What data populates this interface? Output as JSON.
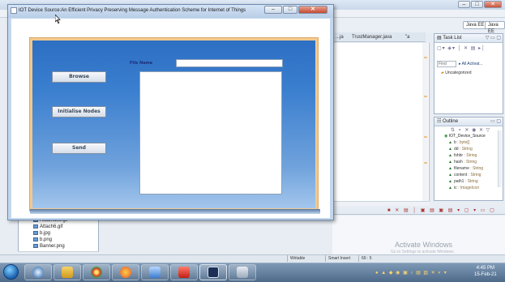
{
  "eclipse": {
    "perspectives": [
      "Java EE",
      "Java EE"
    ],
    "editor_tabs": [
      "...ja",
      "TrustManager.java",
      "\"a"
    ],
    "task_list": {
      "title": "Task List",
      "find_placeholder": "Find",
      "filter": "All  Activat...",
      "category": "Uncategorized"
    },
    "outline": {
      "title": "Outline",
      "root": "IOT_Device_Source",
      "items": [
        {
          "name": "b",
          "type": ": byte[]"
        },
        {
          "name": "dd",
          "type": ": String"
        },
        {
          "name": "fshbr",
          "type": ": String"
        },
        {
          "name": "hash",
          "type": ": String"
        },
        {
          "name": "filename",
          "type": ": String"
        },
        {
          "name": "content",
          "type": ": String"
        },
        {
          "name": "path1",
          "type": ": String"
        },
        {
          "name": "ic",
          "type": ": ImageIcon"
        }
      ]
    },
    "package_explorer": {
      "items": [
        "Attachaso.gif",
        "Attach6.gif",
        "b.jpg",
        "b.png",
        "Banner.png"
      ]
    },
    "status": {
      "writable": "Writable",
      "insert_mode": "Smart Insert",
      "position": "69 : 5"
    },
    "activate_windows": "Activate Windows",
    "activate_windows_sub": "Go to Settings to activate Windows."
  },
  "dialog": {
    "title": "IOT Device Source:An Efficient Privacy Preserving Message Authentication Scheme for Internet of Things",
    "buttons": {
      "browse": "Browse",
      "initialise": "Initialise Nodes",
      "send": "Send"
    },
    "file_name_label": "File Name",
    "file_name_value": "",
    "text_area_value": ""
  },
  "taskbar": {
    "clock_time": "4:45 PM",
    "clock_date": "15-Feb-21"
  },
  "colors": {
    "panel_top": "#2d6fc3",
    "panel_bottom": "#a3c6ec",
    "panel_border": "#f1c98d",
    "label_blue": "#1c2f7a"
  }
}
